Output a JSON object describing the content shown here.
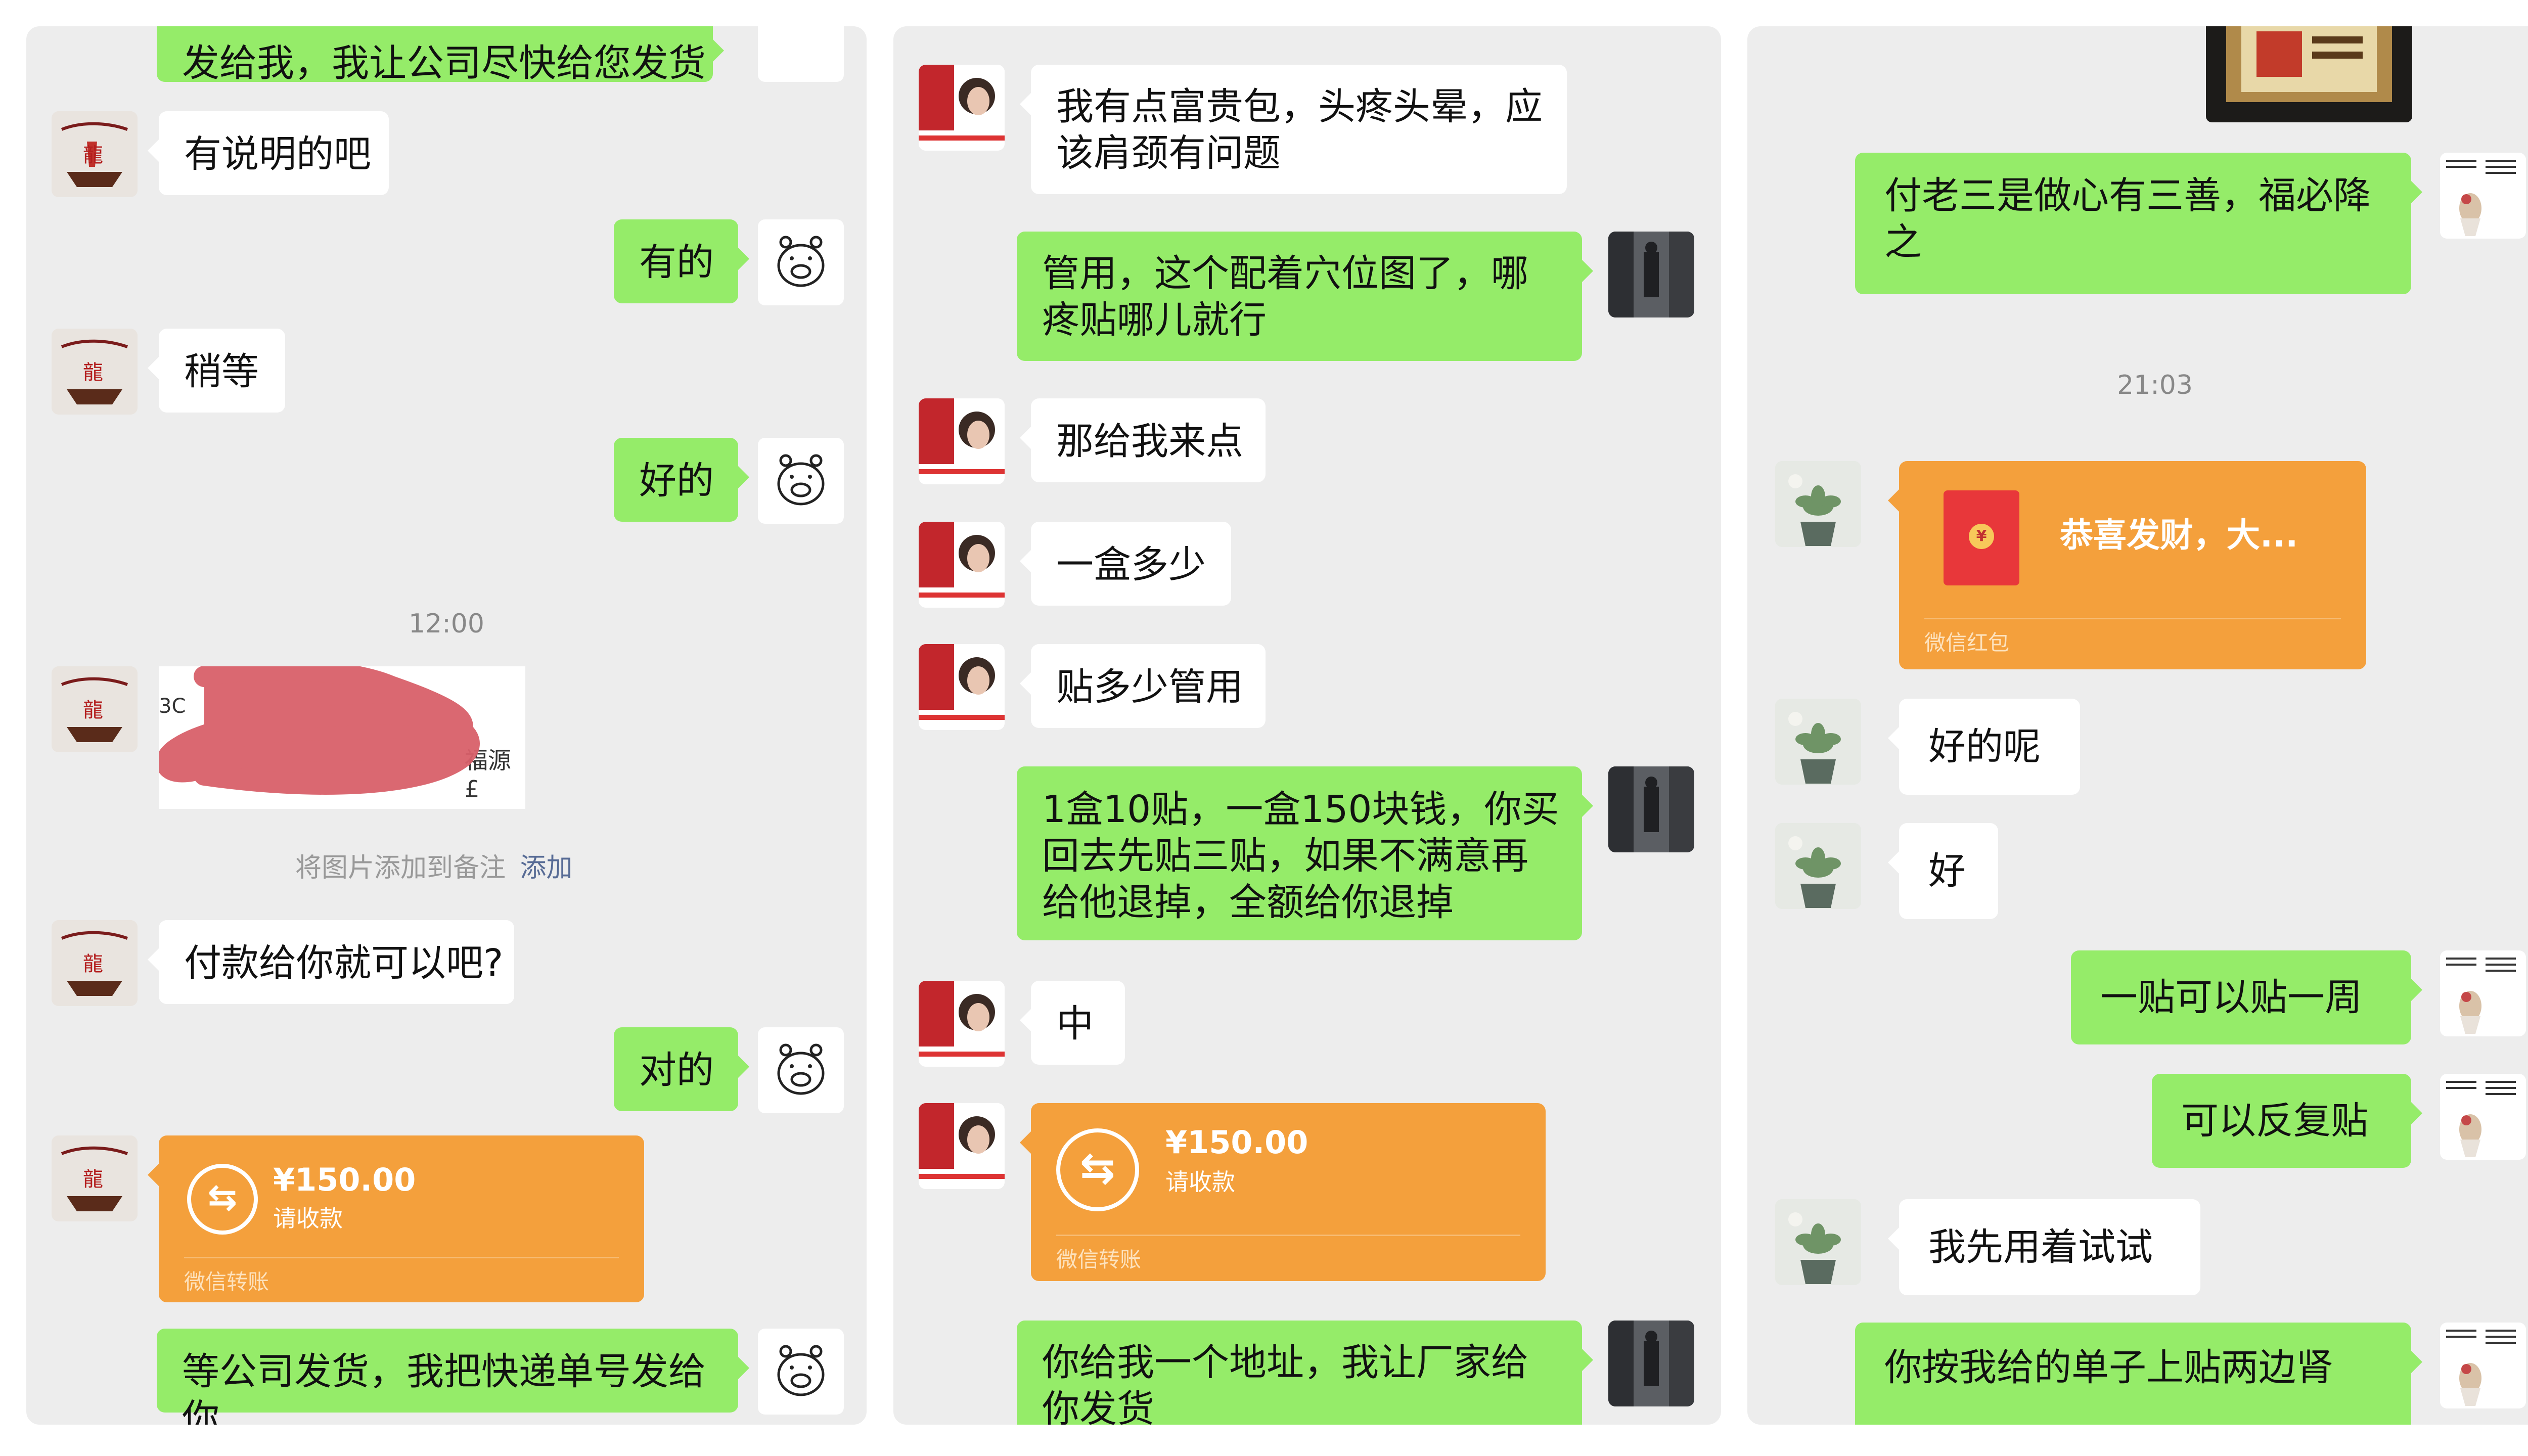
{
  "panel1": {
    "msg_top": "发给我，我让公司尽快给您发货",
    "msg_q1": "有说明的吧",
    "msg_a1": "有的",
    "msg_q2": "稍等",
    "msg_a2": "好的",
    "time1": "12:00",
    "img_frag_left": "3C",
    "img_frag_right": "福源£",
    "note_text": "将图片添加到备注",
    "note_link": "添加",
    "msg_q3": "付款给你就可以吧?",
    "msg_a3": "对的",
    "transfer": {
      "amount": "¥150.00",
      "status": "请收款",
      "footer": "微信转账"
    },
    "msg_last": "等公司发货，我把快递单号发给你"
  },
  "panel2": {
    "msg_1": "我有点富贵包，头疼头晕，应该肩颈有问题",
    "msg_2": "管用，这个配着穴位图了，哪疼贴哪儿就行",
    "msg_3": "那给我来点",
    "msg_4": "一盒多少",
    "msg_5": "贴多少管用",
    "msg_6": "1盒10贴，一盒150块钱，你买回去先贴三贴，如果不满意再给他退掉，全额给你退掉",
    "msg_7": "中",
    "transfer": {
      "amount": "¥150.00",
      "status": "请收款",
      "footer": "微信转账"
    },
    "msg_8": "你给我一个地址，我让厂家给你发货"
  },
  "panel3": {
    "msg_1": "付老三是做心有三善，福必降之",
    "time1": "21:03",
    "red_packet": {
      "title": "恭喜发财，大...",
      "footer": "微信红包"
    },
    "msg_2": "好的呢",
    "msg_3": "好",
    "msg_4": "一贴可以贴一周",
    "msg_5": "可以反复贴",
    "msg_6": "我先用着试试",
    "msg_7": "你按我给的单子上贴两边肾"
  },
  "colors": {
    "panel_bg": "#ededed",
    "bubble_out": "#95ec69",
    "bubble_in": "#ffffff",
    "transfer": "#f4a03c",
    "link": "#576b95",
    "redacted": "#d9606a"
  },
  "icons": [
    "pig-avatar",
    "dragon-boat-avatar",
    "woman-avatar",
    "street-photo-avatar",
    "plant-avatar",
    "calligraphy-avatar",
    "transfer-arrows-icon",
    "red-packet-icon"
  ]
}
